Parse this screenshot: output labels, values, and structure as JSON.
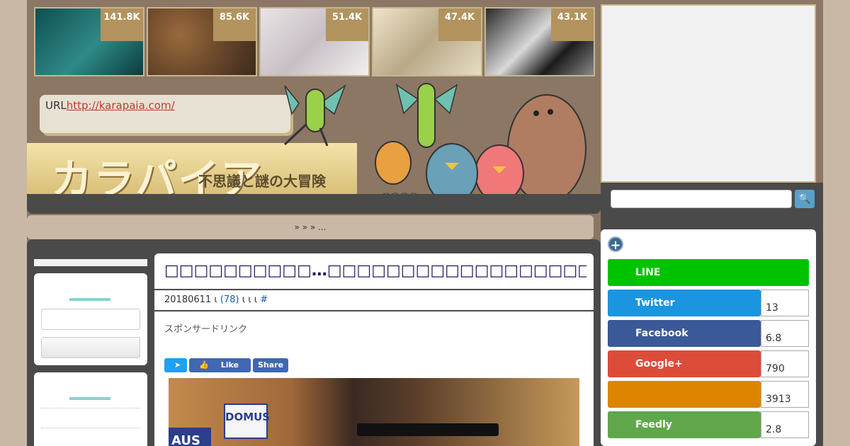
{
  "thumbnails": [
    {
      "count": "141.8K"
    },
    {
      "count": "85.6K"
    },
    {
      "count": "51.4K"
    },
    {
      "count": "47.4K"
    },
    {
      "count": "43.1K"
    }
  ],
  "url_box": {
    "label": "URL",
    "link": "http://karapaia.com/"
  },
  "logo": {
    "title": "カラパイア",
    "subtitle": "不思議と謎の大冒険"
  },
  "breadcrumb": {
    "text": "»   »   » ..."
  },
  "article": {
    "title": "□□□□□□□□□□…□□□□□□□□□□□□□□□□□□□□□□□□□□□□",
    "date": "20180611",
    "sep1": "ι",
    "comments": "(78)",
    "sep2": "ι ι ι",
    "hash": "#",
    "sponsor": "スポンサードリンク",
    "share_like": "Like",
    "share_share": "Share",
    "photo_sign": "DOMUS",
    "photo_blue": "AUS"
  },
  "share_buttons": [
    {
      "label": "LINE",
      "count": "",
      "color": "#00c300"
    },
    {
      "label": "Twitter",
      "count": "13",
      "color": "#1b95e0"
    },
    {
      "label": "Facebook",
      "count": "6.8",
      "color": "#3b5998"
    },
    {
      "label": "Google+",
      "count": "790",
      "color": "#dd4b39"
    },
    {
      "label": "",
      "count": "3913",
      "color": "#dd8500"
    },
    {
      "label": "Feedly",
      "count": "2.8",
      "color": "#5fa74a"
    }
  ]
}
